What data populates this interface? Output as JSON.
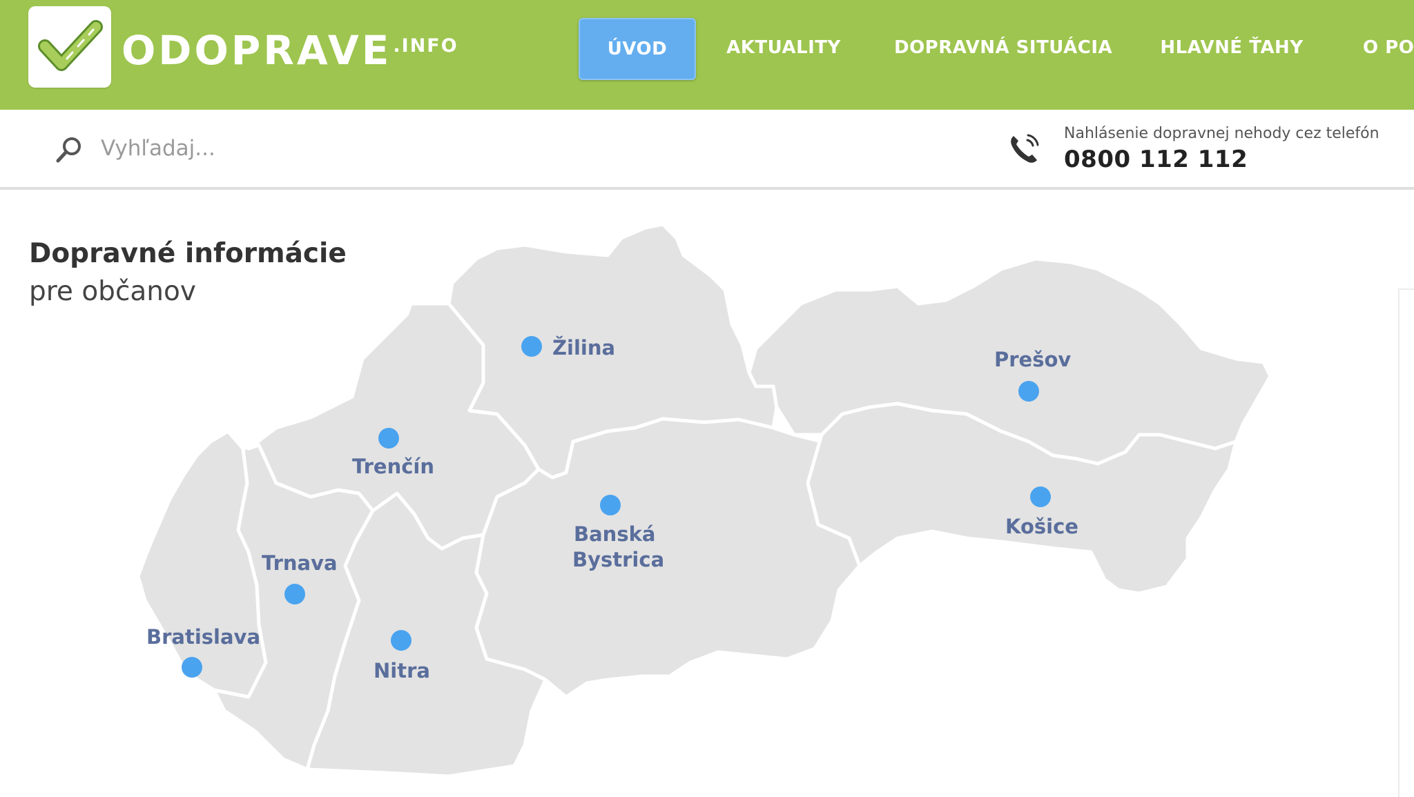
{
  "header": {
    "brand_name": "ODOPRAVE",
    "brand_tld": ".INFO",
    "nav": [
      {
        "label": "ÚVOD",
        "active": true
      },
      {
        "label": "AKTUALITY",
        "active": false
      },
      {
        "label": "DOPRAVNÁ SITUÁCIA",
        "active": false
      },
      {
        "label": "HLAVNÉ ŤAHY",
        "active": false
      },
      {
        "label": "O PO",
        "active": false
      }
    ]
  },
  "search": {
    "placeholder": "Vyhľadaj..."
  },
  "contact": {
    "label": "Nahlásenie dopravnej nehody cez telefón",
    "phone": "0800 112 112"
  },
  "content": {
    "title": "Dopravné informácie",
    "subtitle": "pre občanov"
  },
  "map": {
    "regions": [
      {
        "name": "Bratislava",
        "label": "Bratislava"
      },
      {
        "name": "Trnava",
        "label": "Trnava"
      },
      {
        "name": "Nitra",
        "label": "Nitra"
      },
      {
        "name": "Trenčín",
        "label": "Trenčín"
      },
      {
        "name": "Žilina",
        "label": "Žilina"
      },
      {
        "name": "Banská Bystrica",
        "label_line1": "Banská",
        "label_line2": "Bystrica"
      },
      {
        "name": "Prešov",
        "label": "Prešov"
      },
      {
        "name": "Košice",
        "label": "Košice"
      }
    ]
  },
  "colors": {
    "header_bg": "#9ec54f",
    "nav_active_bg": "#64aef0",
    "region_fill": "#e3e3e3",
    "city_dot": "#4aa3ef",
    "city_label": "#5a6e9c"
  }
}
